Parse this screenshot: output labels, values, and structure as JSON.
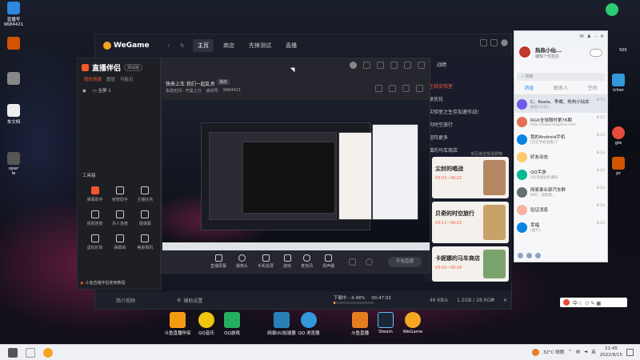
{
  "desktop": {
    "icons_left": [
      {
        "label": "直播号\n9684421",
        "color": "#2e86de"
      },
      {
        "label": "",
        "color": "#d35400"
      },
      {
        "label": "",
        "color": "#888"
      },
      {
        "label": "本文档",
        "color": "#eee"
      },
      {
        "label": "oper\nle",
        "color": "#555"
      }
    ],
    "icons_bottom": [
      "斗鱼直播伴侣",
      "QQ音乐",
      "QQ游戏",
      "网易UU加速器",
      "QQ 浏览器",
      "斗鱼直播",
      "Steam",
      "WeGame"
    ],
    "icons_right": [
      "icher",
      "gle",
      "pr"
    ],
    "top_right_label": "",
    "right_edge": "500"
  },
  "wegame": {
    "logo": "WeGame",
    "nav": [
      "主页",
      "商店",
      "先锋测试",
      "直播"
    ],
    "active_nav": "主页",
    "bottom_left": "简介视频",
    "bottom_settings": "辅助设置",
    "download_status": "下载中 - 4.48%",
    "download_time": "00:47:02",
    "download_speed": "46 KB/s",
    "download_size": "1.2GB / 28.6GB",
    "progress": 0.0448
  },
  "zbbl": {
    "title": "直播伴侣",
    "version": "测试版",
    "tabs": [
      "我的场景",
      "图层",
      "可能见"
    ],
    "scene": "全屏 1",
    "tools_title": "工具箱",
    "tools": [
      "弹幕助手",
      "房管助手",
      "主播任务",
      "视频连麦",
      "多人连麦",
      "摄弹幕",
      "虚拟形象",
      "弹幕库",
      "美颜相机"
    ],
    "footer": "斗鱼直播伴侣使用教程"
  },
  "preview": {
    "title": "快来上车 我们一起乱杀",
    "tag": "播放",
    "sub": [
      "永劫无间 · 开黑上分",
      "房间号",
      "9684421"
    ],
    "controls": [
      "直播屏幕",
      "摄像头",
      "手机投屏",
      "游戏",
      "麦克风",
      "扬声器"
    ],
    "start_button": "开始直播"
  },
  "side": {
    "header": "战绩",
    "lines": [
      "在线实验室",
      "联优化",
      "实验室之生存加速作战!",
      "的时空旅行",
      "怪阵更多",
      "蹭的马车商店"
    ],
    "region_note": "本区域全部消费物",
    "cards": [
      {
        "title": "尘封的唱战",
        "date": "03-01~09-22",
        "art": "#b58863"
      },
      {
        "title": "贝奇的时空旅行",
        "date": "03-11~09-22",
        "art": "#c9a26a"
      },
      {
        "title": "卡妮娜的马车商店",
        "date": "03-01~09-28",
        "art": "#7aa36d"
      }
    ]
  },
  "qq": {
    "name": "热热小仙...",
    "signature": "编辑个性签名",
    "search_placeholder": "搜索",
    "tabs": [
      "消息",
      "联系人",
      "空间"
    ],
    "messages": [
      {
        "name": "C、Koala、李威、热热小仙女",
        "preview": "群组(12名)",
        "time": "8-15",
        "color": "#6c5ce7"
      },
      {
        "name": "RGX全球限时第76期",
        "preview": "http://www.dmgame.com",
        "time": "8-15",
        "color": "#e17055"
      },
      {
        "name": "我的Android手机",
        "preview": "[已在手机查看]了",
        "time": "8-13",
        "color": "#0984e3"
      },
      {
        "name": "好友动态",
        "preview": "",
        "time": "8-13",
        "color": "#fdcb6e"
      },
      {
        "name": "QQ手游",
        "preview": "QQ消息助手通知",
        "time": "8-12",
        "color": "#00b894"
      },
      {
        "name": "网易事业部汽车群",
        "preview": "你好，请帮我...",
        "time": "8-12",
        "color": "#636e72"
      },
      {
        "name": "验证消息",
        "preview": "",
        "time": "8-10",
        "color": "#fab1a0"
      },
      {
        "name": "幸福",
        "preview": "[图片]",
        "time": "8-10",
        "color": "#0984e3"
      }
    ]
  },
  "taskbar": {
    "temp": "32°C 晴朗",
    "time": "21:45",
    "date": "2022/8/15"
  }
}
